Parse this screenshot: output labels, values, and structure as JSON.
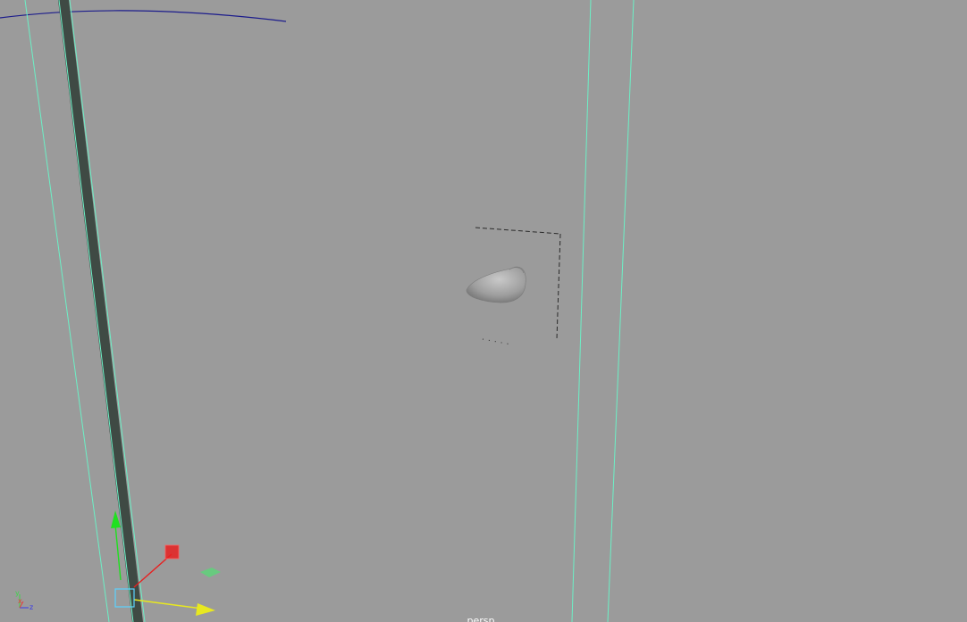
{
  "viewport": {
    "camera_name": "persp",
    "background_color": "#9b9b9b"
  },
  "axis_indicator": {
    "x_label": "x",
    "y_label": "y",
    "z_label": "z",
    "x_color": "#e83a3a",
    "y_color": "#3ed64a",
    "z_color": "#3a3ae8"
  },
  "manipulator": {
    "x_color": "#e82020",
    "y_color": "#20e020",
    "z_color": "#e8e820",
    "center_color": "#5ad2ff",
    "plane_color": "#5fd27a"
  },
  "scene": {
    "nurbs_curve_color": "#6cf0c6",
    "selected_column_color": "#3f4a44",
    "horizon_curve_color": "#1c1c8c",
    "object_bbox_color": "#2a2a2a"
  }
}
